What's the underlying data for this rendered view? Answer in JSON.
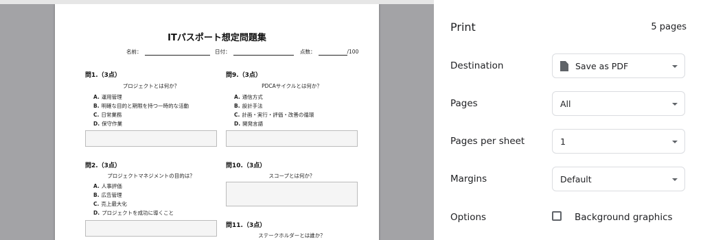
{
  "document": {
    "title": "ITパスポート想定問題集",
    "name_label": "名前：",
    "date_label": "日付：",
    "score_label": "点数：",
    "score_total": "/100",
    "questions": [
      {
        "title": "問1.（3点）",
        "text": "プロジェクトとは何か？",
        "options": [
          {
            "key": "A.",
            "text": "運用管理"
          },
          {
            "key": "B.",
            "text": "明確な目的と期限を持つ一時的な活動"
          },
          {
            "key": "C.",
            "text": "日常業務"
          },
          {
            "key": "D.",
            "text": "保守作業"
          }
        ]
      },
      {
        "title": "問9.（3点）",
        "text": "PDCAサイクルとは何か？",
        "options": [
          {
            "key": "A.",
            "text": "通信方式"
          },
          {
            "key": "B.",
            "text": "設計手法"
          },
          {
            "key": "C.",
            "text": "計画・実行・評価・改善の循環"
          },
          {
            "key": "D.",
            "text": "開発言語"
          }
        ]
      },
      {
        "title": "問2.（3点）",
        "text": "プロジェクトマネジメントの目的は？",
        "options": [
          {
            "key": "A.",
            "text": "人事評価"
          },
          {
            "key": "B.",
            "text": "広告管理"
          },
          {
            "key": "C.",
            "text": "売上最大化"
          },
          {
            "key": "D.",
            "text": "プロジェクトを成功に導くこと"
          }
        ]
      },
      {
        "title": "問10.（3点）",
        "text": "スコープとは何か？"
      },
      {
        "title": "問11.（3点）",
        "text": "ステークホルダーとは誰か？"
      }
    ]
  },
  "print_panel": {
    "title": "Print",
    "pages_count": "5 pages",
    "destination": {
      "label": "Destination",
      "value": "Save as PDF",
      "icon": "pdf-file-icon"
    },
    "pages": {
      "label": "Pages",
      "value": "All"
    },
    "pages_per_sheet": {
      "label": "Pages per sheet",
      "value": "1"
    },
    "margins": {
      "label": "Margins",
      "value": "Default"
    },
    "options": {
      "label": "Options",
      "background_graphics": "Background graphics",
      "background_graphics_checked": false
    }
  }
}
